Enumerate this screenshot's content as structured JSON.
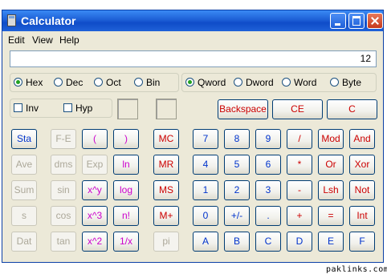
{
  "window": {
    "title": "Calculator"
  },
  "menu": {
    "edit": "Edit",
    "view": "View",
    "help": "Help"
  },
  "display": {
    "value": "12"
  },
  "base": {
    "hex": "Hex",
    "dec": "Dec",
    "oct": "Oct",
    "bin": "Bin",
    "selected": "Hex"
  },
  "word_size": {
    "qword": "Qword",
    "dword": "Dword",
    "word": "Word",
    "byte": "Byte",
    "selected": "Qword"
  },
  "checks": {
    "inv": "Inv",
    "hyp": "Hyp"
  },
  "edit_buttons": {
    "backspace": "Backspace",
    "ce": "CE",
    "c": "C"
  },
  "stat_buttons": {
    "sta": "Sta",
    "ave": "Ave",
    "sum": "Sum",
    "s": "s",
    "dat": "Dat"
  },
  "sci_buttons": {
    "fe": "F-E",
    "lparen": "(",
    "rparen": ")",
    "dms": "dms",
    "exp": "Exp",
    "ln": "ln",
    "sin": "sin",
    "xy": "x^y",
    "log": "log",
    "cos": "cos",
    "x3": "x^3",
    "nfact": "n!",
    "tan": "tan",
    "x2": "x^2",
    "recip": "1/x"
  },
  "memory_buttons": {
    "mc": "MC",
    "mr": "MR",
    "ms": "MS",
    "mplus": "M+",
    "pi": "pi"
  },
  "keypad": {
    "rows": [
      [
        "7",
        "8",
        "9",
        "/",
        "Mod",
        "And"
      ],
      [
        "4",
        "5",
        "6",
        "*",
        "Or",
        "Xor"
      ],
      [
        "1",
        "2",
        "3",
        "-",
        "Lsh",
        "Not"
      ],
      [
        "0",
        "+/-",
        ".",
        "+",
        "=",
        "Int"
      ],
      [
        "A",
        "B",
        "C",
        "D",
        "E",
        "F"
      ]
    ]
  },
  "watermark": "paklinks.com"
}
